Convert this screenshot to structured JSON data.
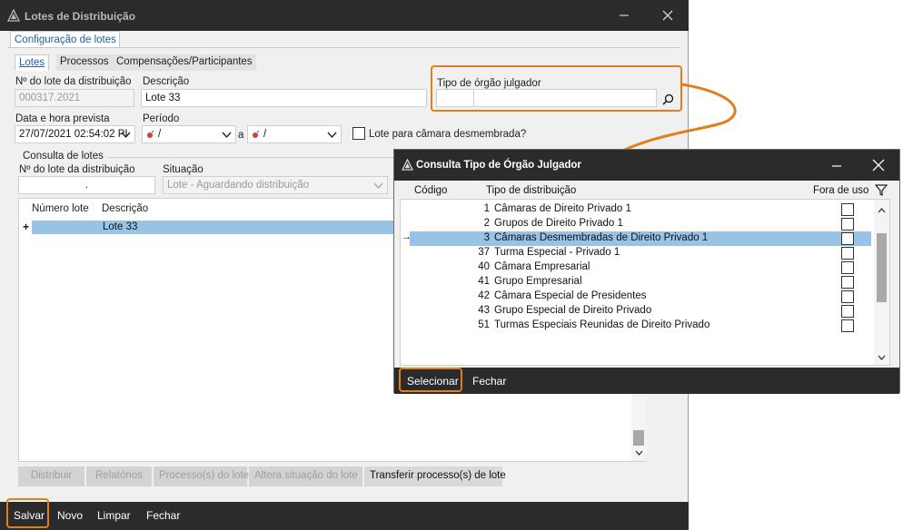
{
  "main_window": {
    "title": "Lotes de Distribuição",
    "top_tab": "Configuração de lotes",
    "sub_tabs": [
      "Lotes",
      "Processos",
      "Compensações/Participantes"
    ],
    "fields": {
      "lot_number_label": "Nº do lote da distribuição",
      "lot_number_value": "000317.2021",
      "description_label": "Descrição",
      "description_value": "Lote 33",
      "org_type_label": "Tipo de órgão julgador",
      "datetime_label": "Data e hora prevista",
      "datetime_value": "27/07/2021 02:54:02 PI",
      "period_label": "Período",
      "period_from": "/",
      "period_sep": "a",
      "period_to": "/",
      "split_chamber_label": "Lote para câmara desmembrada?"
    },
    "query": {
      "group_label": "Consulta de lotes",
      "lot_number_label": "Nº do lote da distribuição",
      "lot_number_value": ".",
      "status_label": "Situação",
      "status_value": "Lote - Aguardando distribuição"
    },
    "grid": {
      "columns": [
        "Número lote",
        "Descrição"
      ],
      "rows": [
        {
          "expander": "+",
          "number": "",
          "description": "Lote 33"
        }
      ]
    },
    "action_buttons": [
      "Distribuir",
      "Relatórios",
      "Processo(s) do lote",
      "Altera situação do lote",
      "Transferir processo(s) de lote"
    ],
    "bottom_buttons": [
      "Salvar",
      "Novo",
      "Limpar",
      "Fechar"
    ]
  },
  "dialog": {
    "title": "Consulta Tipo de Órgão Julgador",
    "columns": {
      "code": "Código",
      "type": "Tipo de distribuição",
      "out_of_use": "Fora de uso"
    },
    "rows": [
      {
        "code": "1",
        "name": "Câmaras de Direito Privado 1",
        "selected": false
      },
      {
        "code": "2",
        "name": "Grupos de Direito Privado 1",
        "selected": false
      },
      {
        "code": "3",
        "name": "Câmaras Desmembradas de Direito Privado 1",
        "selected": true
      },
      {
        "code": "37",
        "name": "Turma Especial - Privado 1",
        "selected": false
      },
      {
        "code": "40",
        "name": "Câmara Empresarial",
        "selected": false
      },
      {
        "code": "41",
        "name": "Grupo Empresarial",
        "selected": false
      },
      {
        "code": "42",
        "name": "Câmara Especial de Presidentes",
        "selected": false
      },
      {
        "code": "43",
        "name": "Grupo Especial de Direito Privado",
        "selected": false
      },
      {
        "code": "51",
        "name": "Turmas Especiais Reunidas de Direito Privado",
        "selected": false
      }
    ],
    "row_pointer": "→",
    "footer_buttons": [
      "Selecionar",
      "Fechar"
    ]
  },
  "colors": {
    "highlight": "#e07f1f",
    "selection": "#96c3e6",
    "titlebar": "#2b2b2b",
    "tab_text": "#1f5fa8"
  }
}
